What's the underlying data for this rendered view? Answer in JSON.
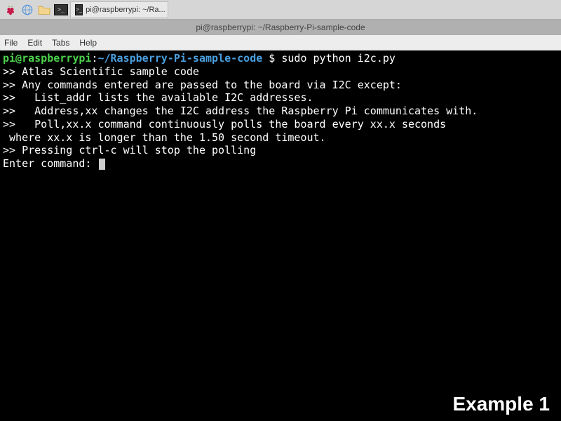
{
  "taskbar": {
    "app_label": "pi@raspberrypi: ~/Ra..."
  },
  "window": {
    "title": "pi@raspberrypi: ~/Raspberry-Pi-sample-code"
  },
  "menubar": {
    "items": [
      "File",
      "Edit",
      "Tabs",
      "Help"
    ]
  },
  "terminal": {
    "prompt": {
      "user_host": "pi@raspberrypi",
      "colon": ":",
      "path": "~/Raspberry-Pi-sample-code",
      "dollar": " $ ",
      "command": "sudo python i2c.py"
    },
    "lines": [
      ">> Atlas Scientific sample code",
      ">> Any commands entered are passed to the board via I2C except:",
      ">>   List_addr lists the available I2C addresses.",
      ">>   Address,xx changes the I2C address the Raspberry Pi communicates with.",
      ">>   Poll,xx.x command continuously polls the board every xx.x seconds",
      " where xx.x is longer than the 1.50 second timeout.",
      ">> Pressing ctrl-c will stop the polling",
      "Enter command: "
    ]
  },
  "overlay": {
    "example_label": "Example 1"
  }
}
